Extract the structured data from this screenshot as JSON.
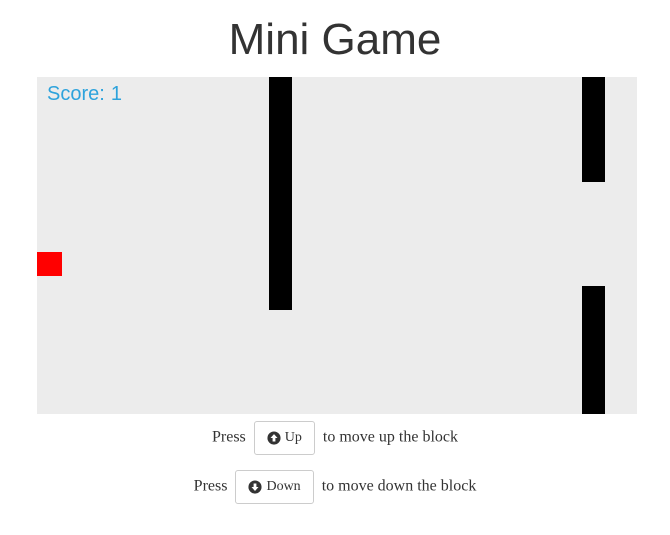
{
  "page": {
    "title": "Mini Game"
  },
  "game": {
    "score_label": "Score:",
    "score_value": "1",
    "colors": {
      "background": "#ececec",
      "pipe": "#000000",
      "player": "#ff0000",
      "score_text": "#2ea3dc"
    }
  },
  "controls": {
    "up": {
      "prefix": "Press",
      "button_label": "Up",
      "icon": "arrow-circle-up-icon",
      "suffix": "to move up the block"
    },
    "down": {
      "prefix": "Press",
      "button_label": "Down",
      "icon": "arrow-circle-down-icon",
      "suffix": "to move down the block"
    }
  }
}
